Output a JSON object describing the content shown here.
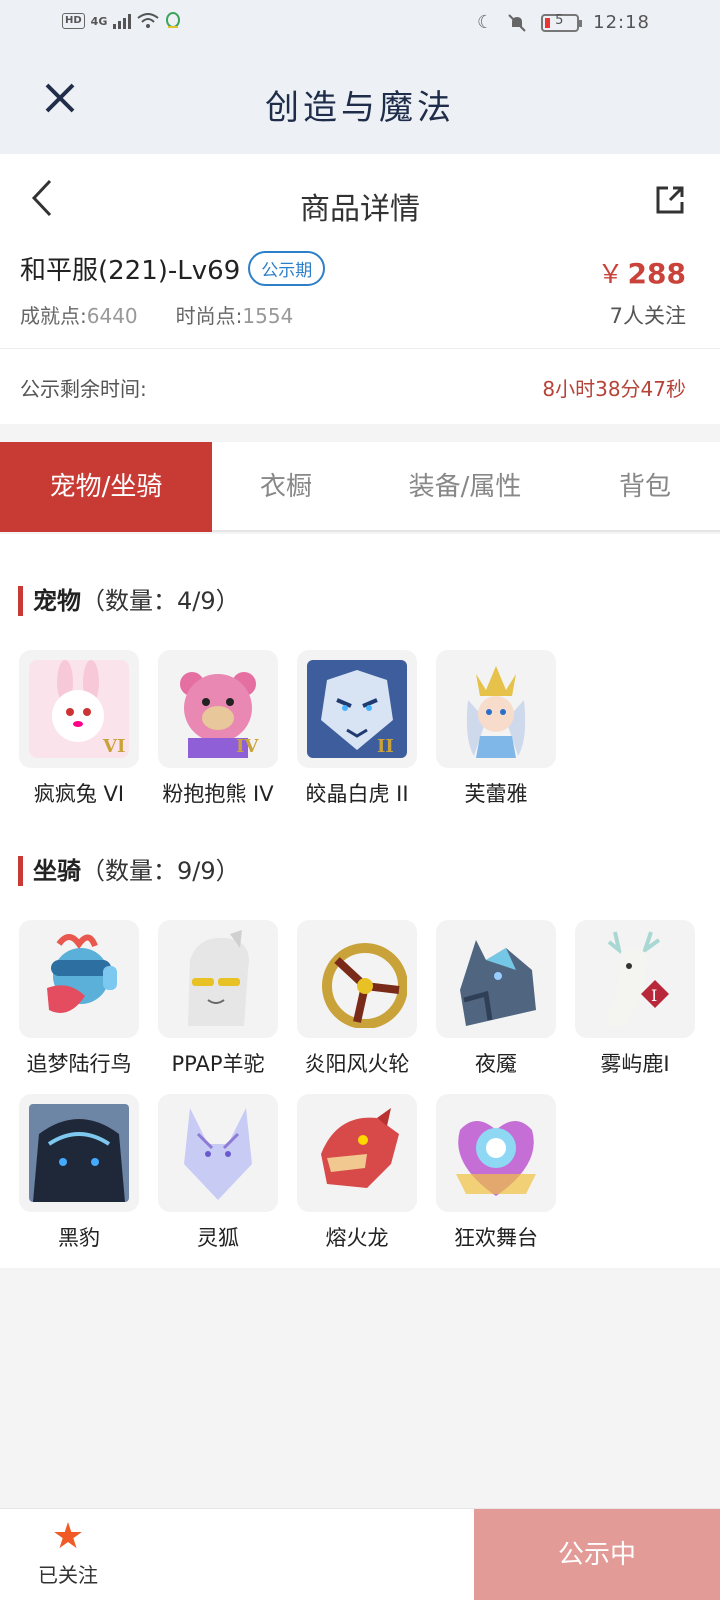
{
  "status_bar": {
    "hd": "HD",
    "network": "4G",
    "time": "12:18",
    "battery_level": "5"
  },
  "app": {
    "title": "创造与魔法"
  },
  "page": {
    "title": "商品详情"
  },
  "product": {
    "name": "和平服(221)-Lv69",
    "tag": "公示期",
    "achievement_label": "成就点:",
    "achievement_value": "6440",
    "fashion_label": "时尚点:",
    "fashion_value": "1554",
    "currency": "￥",
    "price": "288",
    "followers": "7人关注"
  },
  "countdown": {
    "label": "公示剩余时间:",
    "value": "8小时38分47秒"
  },
  "tabs": [
    {
      "label": "宠物/坐骑",
      "active": true
    },
    {
      "label": "衣橱",
      "active": false
    },
    {
      "label": "装备/属性",
      "active": false
    },
    {
      "label": "背包",
      "active": false
    }
  ],
  "pets": {
    "title": "宠物",
    "count": "（数量：4/9）",
    "items": [
      {
        "label": "疯疯兔 VI",
        "icon": "rabbit-icon",
        "color": "#f4c2d4"
      },
      {
        "label": "粉抱抱熊 IV",
        "icon": "bear-icon",
        "color": "#e89bb8"
      },
      {
        "label": "皎晶白虎 II",
        "icon": "tiger-icon",
        "color": "#6f8fc9"
      },
      {
        "label": "芙蕾雅",
        "icon": "fairy-icon",
        "color": "#cfe3f4"
      }
    ]
  },
  "mounts": {
    "title": "坐骑",
    "count": "（数量：9/9）",
    "items": [
      {
        "label": "追梦陆行鸟",
        "icon": "bird-icon",
        "color": "#69b7df"
      },
      {
        "label": "PPAP羊驼",
        "icon": "alpaca-icon",
        "color": "#d8d8d8"
      },
      {
        "label": "炎阳风火轮",
        "icon": "wheel-icon",
        "color": "#c9a23a"
      },
      {
        "label": "夜魇",
        "icon": "nightmare-horse-icon",
        "color": "#5e7690"
      },
      {
        "label": "雾屿鹿I",
        "icon": "deer-icon",
        "color": "#e9eef0"
      },
      {
        "label": "黑豹",
        "icon": "panther-icon",
        "color": "#2c3a52"
      },
      {
        "label": "灵狐",
        "icon": "fox-icon",
        "color": "#c5c9f2"
      },
      {
        "label": "熔火龙",
        "icon": "dragon-icon",
        "color": "#d84a4a"
      },
      {
        "label": "狂欢舞台",
        "icon": "stage-icon",
        "color": "#c56fd6"
      }
    ]
  },
  "bottom": {
    "follow_label": "已关注",
    "status_label": "公示中"
  },
  "colors": {
    "accent": "#c83a34",
    "price": "#c9433a",
    "tag_blue": "#2e7fc9",
    "status_button": "#e29b97"
  }
}
